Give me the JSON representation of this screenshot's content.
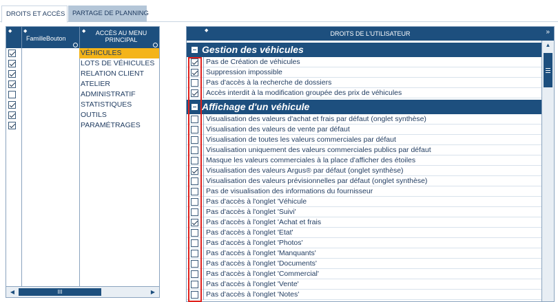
{
  "tabs": [
    {
      "label": "DROITS ET ACCÈS"
    },
    {
      "label": "PARTAGE DE PLANNING"
    }
  ],
  "left_panel": {
    "col_famille": "FamilleBouton",
    "col_acces": "ACCÈS AU MENU PRINCIPAL",
    "rows": [
      {
        "label": "VÉHICULES",
        "checked": true,
        "selected": true
      },
      {
        "label": "LOTS DE VÉHICULES",
        "checked": true
      },
      {
        "label": "RELATION CLIENT",
        "checked": true
      },
      {
        "label": "ATELIER",
        "checked": true
      },
      {
        "label": "ADMINISTRATIF",
        "checked": false
      },
      {
        "label": "STATISTIQUES",
        "checked": true
      },
      {
        "label": "OUTILS",
        "checked": true
      },
      {
        "label": "PARAMÉTRAGES",
        "checked": true
      }
    ],
    "scroll_grip": "III"
  },
  "right_panel": {
    "title": "DROITS DE L'UTILISATEUR",
    "sections": [
      {
        "title": "Gestion des véhicules",
        "items": [
          {
            "label": "Pas de Création de véhicules",
            "checked": true
          },
          {
            "label": "Suppression impossible",
            "checked": true
          },
          {
            "label": "Pas d'accès à la recherche de dossiers",
            "checked": false
          },
          {
            "label": "Accès interdit à la modification groupée des prix de véhicules",
            "checked": true
          }
        ]
      },
      {
        "title": "Affichage d'un véhicule",
        "items": [
          {
            "label": "Visualisation des valeurs d'achat et frais par défaut (onglet synthèse)",
            "checked": false
          },
          {
            "label": "Visualisation des valeurs de vente par défaut",
            "checked": false
          },
          {
            "label": "Visualisation de toutes les valeurs commerciales par défaut",
            "checked": false
          },
          {
            "label": "Visualisation uniquement des valeurs commerciales publics par défaut",
            "checked": false
          },
          {
            "label": "Masque les valeurs commerciales à la place d'afficher des étoiles",
            "checked": false
          },
          {
            "label": "Visualisation des valeurs Argus® par défaut (onglet synthèse)",
            "checked": true
          },
          {
            "label": "Visualisation des valeurs prévisionnelles par défaut (onglet synthèse)",
            "checked": false
          },
          {
            "label": "Pas de visualisation des informations du fournisseur",
            "checked": false
          },
          {
            "label": "Pas d'accès à l'onglet 'Véhicule",
            "checked": false
          },
          {
            "label": "Pas d'accès à l'onglet 'Suivi'",
            "checked": false
          },
          {
            "label": "Pas d'accès à l'onglet 'Achat et frais",
            "checked": true
          },
          {
            "label": "Pas d'accès à l'onglet 'Etat'",
            "checked": false
          },
          {
            "label": "Pas d'accès à l'onglet 'Photos'",
            "checked": false
          },
          {
            "label": "Pas d'accès à l'onglet 'Manquants'",
            "checked": false
          },
          {
            "label": "Pas d'accès à l'onglet 'Documents'",
            "checked": false
          },
          {
            "label": "Pas d'accès à l'onglet 'Commercial'",
            "checked": false
          },
          {
            "label": "Pas d'accès à l'onglet 'Vente'",
            "checked": false
          },
          {
            "label": "Pas d'accès à l'onglet 'Notes'",
            "checked": false
          }
        ]
      }
    ]
  },
  "colors": {
    "header": "#1d4f7e",
    "selection": "#f4b41a",
    "highlight_box": "#e0201b",
    "inactive_tab": "#b4c6d8"
  }
}
